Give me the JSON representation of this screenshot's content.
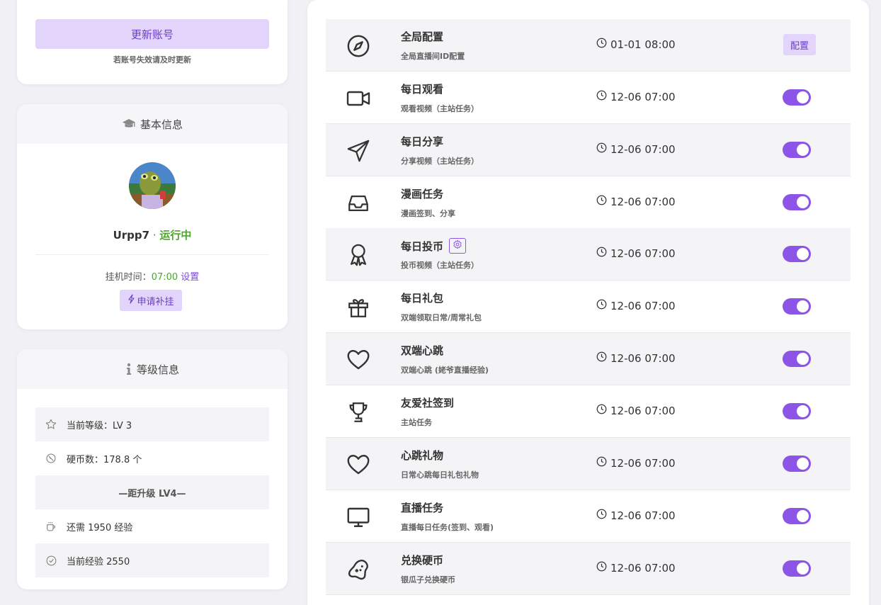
{
  "account": {
    "update_label": "更新账号",
    "hint": "若账号失效请及时更新"
  },
  "basic": {
    "title": "基本信息",
    "username": "Urpp7",
    "separator": " · ",
    "status": "运行中",
    "hang_label": "挂机时间：",
    "hang_time": "07:00",
    "set_label": "设置",
    "apply_label": "申请补挂"
  },
  "level": {
    "title": "等级信息",
    "current_level": "当前等级：LV 3",
    "coins": "硬币数：178.8 个",
    "upgrade_header": "—距升级 LV4—",
    "need_exp": "还需 1950 经验",
    "current_exp": "当前经验 2550"
  },
  "tasks": [
    {
      "title": "全局配置",
      "desc": "全局直播间ID配置",
      "time": "01-01 08:00",
      "action": "配置",
      "icon": "compass-icon"
    },
    {
      "title": "每日观看",
      "desc": "观看视频（主站任务）",
      "time": "12-06 07:00",
      "enabled": true,
      "icon": "video-icon"
    },
    {
      "title": "每日分享",
      "desc": "分享视频（主站任务）",
      "time": "12-06 07:00",
      "enabled": true,
      "icon": "send-icon"
    },
    {
      "title": "漫画任务",
      "desc": "漫画签到、分享",
      "time": "12-06 07:00",
      "enabled": true,
      "icon": "inbox-icon"
    },
    {
      "title": "每日投币",
      "desc": "投币视频（主站任务）",
      "time": "12-06 07:00",
      "enabled": true,
      "icon": "award-icon",
      "has_gear": true
    },
    {
      "title": "每日礼包",
      "desc": "双端领取日常/周常礼包",
      "time": "12-06 07:00",
      "enabled": true,
      "icon": "gift-icon"
    },
    {
      "title": "双端心跳",
      "desc": "双端心跳 (姥爷直播经验)",
      "time": "12-06 07:00",
      "enabled": true,
      "icon": "heart-icon"
    },
    {
      "title": "友爱社签到",
      "desc": "主站任务",
      "time": "12-06 07:00",
      "enabled": true,
      "icon": "trophy-icon"
    },
    {
      "title": "心跳礼物",
      "desc": "日常心跳每日礼包礼物",
      "time": "12-06 07:00",
      "enabled": true,
      "icon": "heart-icon"
    },
    {
      "title": "直播任务",
      "desc": "直播每日任务(签到、观看)",
      "time": "12-06 07:00",
      "enabled": true,
      "icon": "monitor-icon"
    },
    {
      "title": "兑换硬币",
      "desc": "银瓜子兑换硬币",
      "time": "12-06 07:00",
      "enabled": true,
      "icon": "gamepad-icon"
    }
  ],
  "colors": {
    "accent": "#8c55e8",
    "accent_light": "#e3d4fb",
    "running": "#4aa62b"
  }
}
